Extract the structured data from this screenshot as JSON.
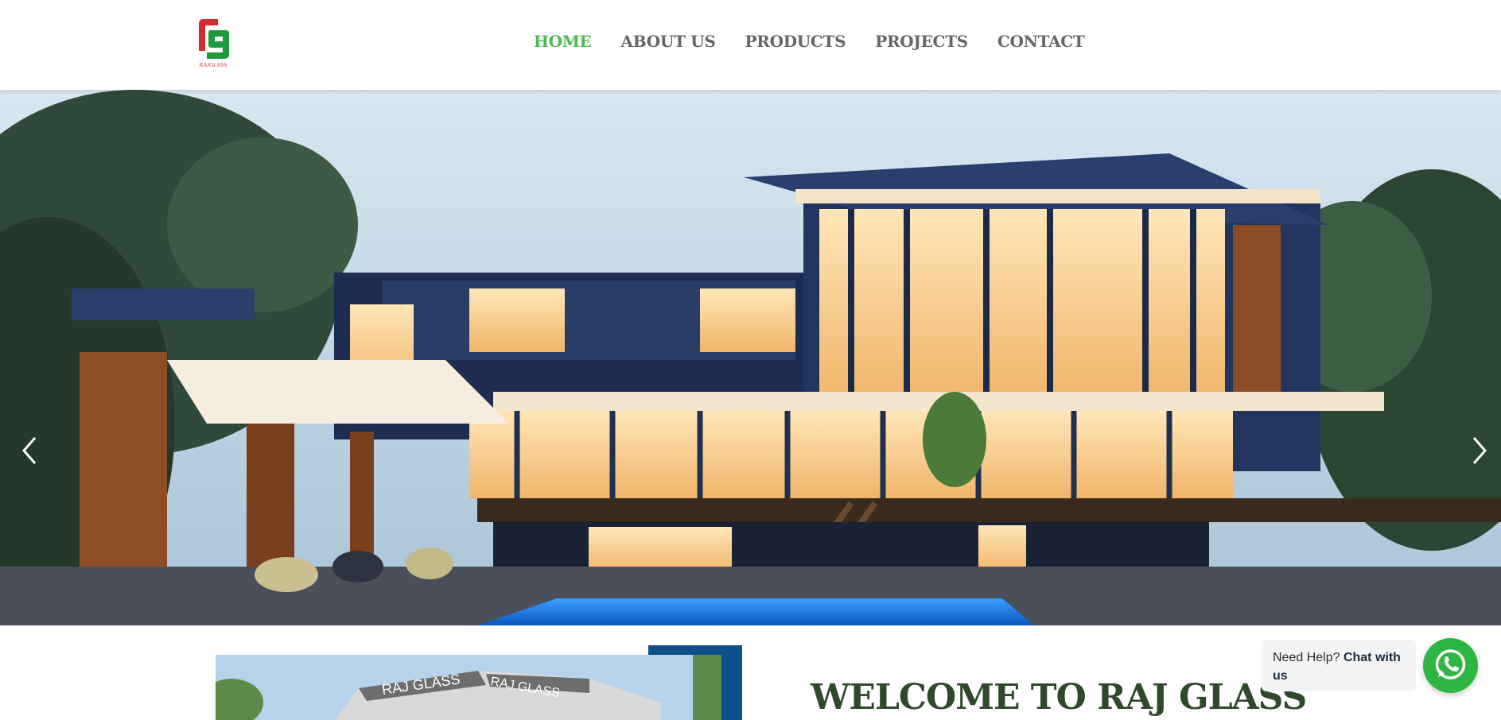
{
  "header": {
    "logo": {
      "brand_part1": "RAJ",
      "brand_part2": "GLASS",
      "icon": "rg-logo-icon"
    },
    "nav": [
      {
        "label": "HOME",
        "active": true
      },
      {
        "label": "ABOUT US",
        "active": false
      },
      {
        "label": "PRODUCTS",
        "active": false
      },
      {
        "label": "PROJECTS",
        "active": false
      },
      {
        "label": "CONTACT",
        "active": false
      }
    ]
  },
  "hero": {
    "prev_icon": "chevron-left-icon",
    "next_icon": "chevron-right-icon"
  },
  "about": {
    "heading": "WELCOME TO RAJ GLASS",
    "image_sign_1": "RAJ GLASS",
    "image_sign_2": "RAJ GLASS"
  },
  "chat": {
    "prefix": "Need Help?",
    "bold": "Chat with us",
    "icon": "whatsapp-icon"
  },
  "colors": {
    "accent_green": "#4cbb52",
    "nav_gray": "#666666",
    "whatsapp": "#2db742",
    "heading_green": "#2f4a2a",
    "frame_blue": "#0c4f8a"
  }
}
